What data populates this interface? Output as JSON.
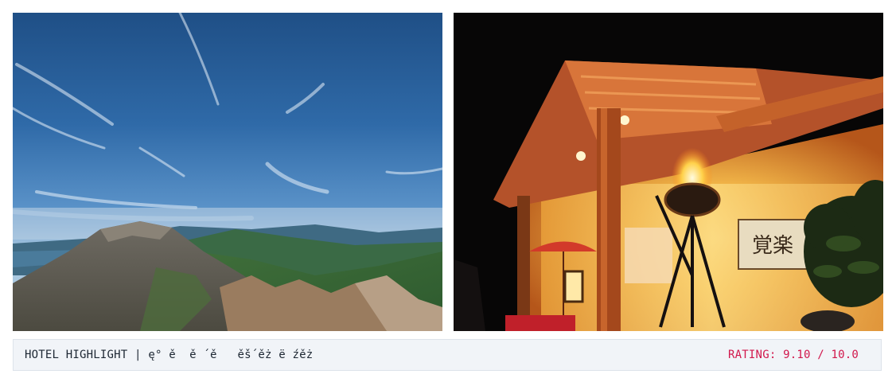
{
  "caption": {
    "title": "HOTEL HIGHLIGHT | ę° ě  ě ´ě   ěš´ěż ë źěż",
    "rating": "RATING: 9.10 / 10.0"
  },
  "images": [
    {
      "name": "volcano-landscape-photo"
    },
    {
      "name": "ryokan-entrance-night-photo",
      "sign_text": "覚楽"
    }
  ],
  "colors": {
    "rating": "#d1174c",
    "caption_bg": "#f1f4f8"
  }
}
